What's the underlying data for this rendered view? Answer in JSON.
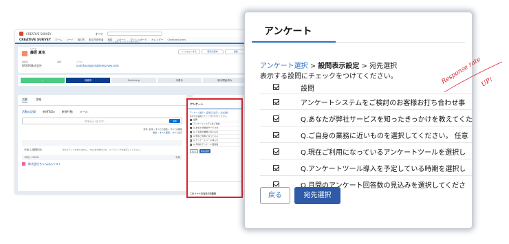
{
  "background_app": {
    "top_logo": "CREATIVE SURVEY",
    "search_scope": "すべて",
    "search_placeholder": "リード 検索 または その他を検索...",
    "brand": "CREATIVE SURVEY",
    "nav_items": [
      "ホーム",
      "リード",
      "取引先",
      "取引先責任者",
      "商談",
      "レポート",
      "ダッシュボード",
      "カレンダー",
      "CreativeSurvey"
    ],
    "lead_type": "リード",
    "lead_name": "藤原 真也",
    "header_buttons": [
      "+ フォローする",
      "取引の変換",
      "編集"
    ],
    "fields": [
      {
        "label": "会社名",
        "value": "WOOR株式会社"
      },
      {
        "label": "電話",
        "value": ""
      },
      {
        "label": "メール",
        "value": "sumihara@creativesurvey.com"
      }
    ],
    "path_steps": [
      "✓",
      "評価中",
      "Nurturing",
      "未着手",
      "取引開始済み"
    ],
    "tabs": [
      "活動",
      "詳細"
    ],
    "activity_actions": [
      "活動の記録",
      "新規ToDo",
      "新規行動",
      "メール"
    ],
    "compose_placeholder": "何を行いますか...",
    "compose_button": "追加",
    "filter_text": "条件: 全体 • すべての活動 • すべての種別",
    "refresh_links": "更新 • すべて展開 • すべて表示",
    "upcoming_header": "今後 & 期限切れ",
    "empty_note": "次のステップはありません。 ToDoを作成するか、ミーティングを設定してください。",
    "month_header": "12月 • 2019",
    "month_right": "今月",
    "list_item": "株式会社ちゃんぽんテスト"
  },
  "mini_card": {
    "title": "アンケート",
    "crumb": "アンケート選択 > 設問表示設定 > 宛先選択",
    "instruction": "表示する設問にチェックをつけてください。",
    "rows": [
      "設問",
      "アンケートシステムをご検討",
      "Q.あなたが弊社サービスを",
      "Q.ご自身の業務に近いもの",
      "Q.現在ご利用になっている",
      "Q.アンケートツール導入を",
      "Q.月間のアンケート回答数"
    ],
    "back": "戻る",
    "next": "宛先選択",
    "footer": "このリードの当年の可能性"
  },
  "card": {
    "title": "アンケート",
    "crumb_link": "アンケート選択",
    "crumb_sep1": " > ",
    "crumb_current": "設問表示設定",
    "crumb_sep2": " > ",
    "crumb_next": "宛先選択",
    "instruction": "表示する設問にチェックをつけてください。",
    "header_col": "設問",
    "questions": [
      "アンケートシステムをご検討のお客様お打ち合わせ事",
      "Q.あなたが弊社サービスを知ったきっかけを教えてくた",
      "Q.ご自身の業務に近いものを選択してください。 任意",
      "Q.現在ご利用になっているアンケートツールを選択し",
      "Q.アンケートツール導入を予定している時期を選択し",
      "Q.月間のアンケート回答数の見込みを選択してくださ"
    ],
    "back_button": "戻る",
    "next_button": "宛先選択"
  },
  "annotation": {
    "line1": "Response rate",
    "line2": "UP!"
  },
  "colors": {
    "accent": "#2f6fc0",
    "primary_button": "#2e5aa8",
    "highlight_frame": "#d9212a"
  }
}
